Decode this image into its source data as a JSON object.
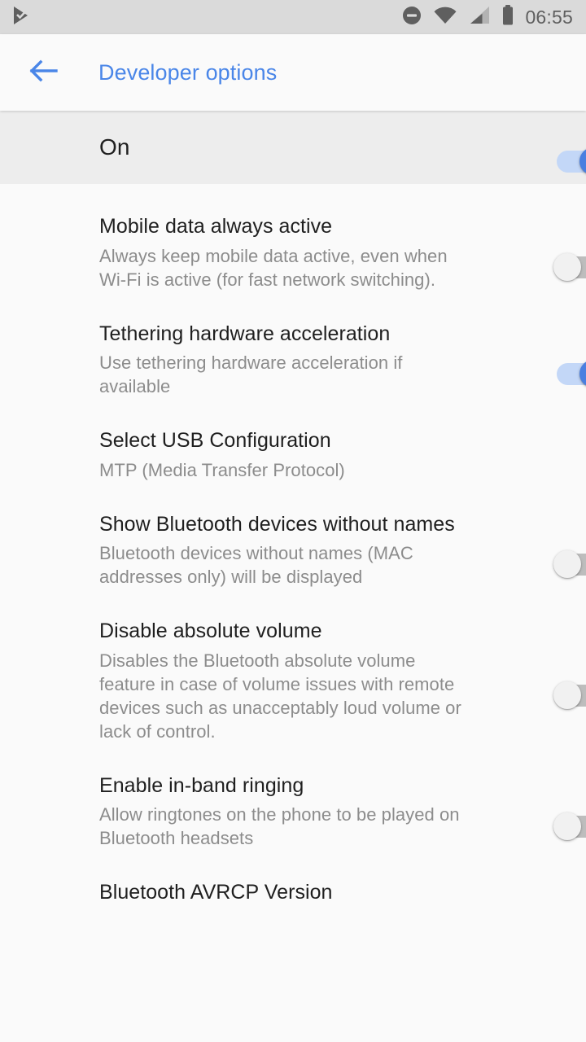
{
  "status_bar": {
    "notification_icon": "play-check-icon",
    "icons": [
      "do-not-disturb-icon",
      "wifi-icon",
      "cellular-signal-icon",
      "battery-icon"
    ],
    "time": "06:55"
  },
  "toolbar": {
    "back_icon": "back-arrow-icon",
    "title": "Developer options",
    "title_color": "#4A86E8"
  },
  "master_switch": {
    "label": "On",
    "state": "on"
  },
  "settings": [
    {
      "title": "Mobile data always active",
      "summary": "Always keep mobile data active, even when Wi-Fi is active (for fast network switching).",
      "control": "switch",
      "state": "off"
    },
    {
      "title": "Tethering hardware acceleration",
      "summary": "Use tethering hardware acceleration if available",
      "control": "switch",
      "state": "on"
    },
    {
      "title": "Select USB Configuration",
      "summary": "MTP (Media Transfer Protocol)",
      "control": "none",
      "state": ""
    },
    {
      "title": "Show Bluetooth devices without names",
      "summary": "Bluetooth devices without names (MAC addresses only) will be displayed",
      "control": "switch",
      "state": "off"
    },
    {
      "title": "Disable absolute volume",
      "summary": "Disables the Bluetooth absolute volume feature in case of volume issues with remote devices such as unacceptably loud volume or lack of control.",
      "control": "switch",
      "state": "off"
    },
    {
      "title": "Enable in-band ringing",
      "summary": "Allow ringtones on the phone to be played on Bluetooth headsets",
      "control": "switch",
      "state": "off"
    },
    {
      "title": "Bluetooth AVRCP Version",
      "summary": "",
      "control": "none",
      "state": ""
    }
  ],
  "colors": {
    "accent": "#4A86E8",
    "switch_on_thumb": "#4A7FE0",
    "switch_on_track": "#C3D7F7",
    "switch_off_track": "#BDBDBD",
    "status_bar_bg": "#DADADA",
    "page_bg": "#FAFAFA",
    "master_bar_bg": "#EDEDED"
  }
}
